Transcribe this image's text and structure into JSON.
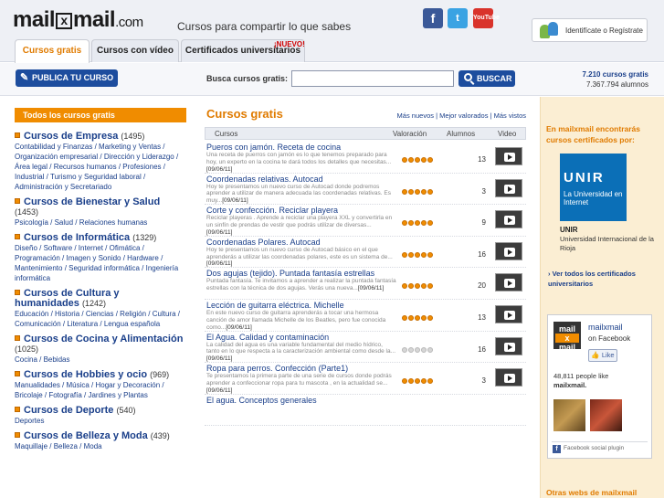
{
  "header": {
    "logo_pre": "mail",
    "logo_x": "x",
    "logo_post": "mail",
    "logo_com": ".com",
    "tagline": "Cursos para compartir lo que sabes",
    "login_label": "Identifícate o Regístrate",
    "facebook_glyph": "f",
    "twitter_glyph": "t",
    "youtube_glyph": "YouTube"
  },
  "tabs": [
    {
      "label": "Cursos gratis",
      "active": true
    },
    {
      "label": "Cursos con vídeo"
    },
    {
      "label": "Certificados universitarios",
      "badge": "¡NUEVO!"
    }
  ],
  "search": {
    "publica_label": "PUBLICA TU CURSO",
    "label": "Busca cursos gratis:",
    "placeholder": "",
    "button_label": "BUSCAR"
  },
  "stats": {
    "courses_count": "7.210",
    "courses_label": "cursos gratis",
    "students": "7.367.794 alumnos"
  },
  "left": {
    "header": "Todos los cursos gratis",
    "categories": [
      {
        "title": "Cursos de Empresa",
        "count": "(1495)",
        "subs": "Contabilidad y Finanzas / Marketing y Ventas / Organización empresarial / Dirección y Liderazgo / Área legal / Recursos humanos / Profesiones / Industrial / Turismo y Seguridad laboral / Administración y Secretariado"
      },
      {
        "title": "Cursos de Bienestar y Salud",
        "count": "(1453)",
        "subs": "Psicología / Salud / Relaciones humanas"
      },
      {
        "title": "Cursos de Informática",
        "count": "(1329)",
        "subs": "Diseño / Software / Internet / Ofimática / Programación / Imagen y Sonido / Hardware / Mantenimiento / Seguridad informática / Ingeniería informática"
      },
      {
        "title": "Cursos de Cultura y humanidades",
        "count": "(1242)",
        "subs": "Educación / Historia / Ciencias / Religión / Cultura / Comunicación / Literatura / Lengua española"
      },
      {
        "title": "Cursos de Cocina y Alimentación",
        "count": "(1025)",
        "subs": "Cocina / Bebidas"
      },
      {
        "title": "Cursos de Hobbies y ocio",
        "count": "(969)",
        "subs": "Manualidades / Música / Hogar y Decoración / Bricolaje / Fotografía / Jardines y Plantas"
      },
      {
        "title": "Cursos de Deporte",
        "count": "(540)",
        "subs": "Deportes"
      },
      {
        "title": "Cursos de Belleza y Moda",
        "count": "(439)",
        "subs": "Maquillaje / Belleza / Moda"
      }
    ]
  },
  "center": {
    "title": "Cursos gratis",
    "sort_links": "Más nuevos | Mejor valorados | Más vistos",
    "columns": {
      "cursos": "Cursos",
      "valoracion": "Valoración",
      "alumnos": "Alumnos",
      "video": "Video"
    },
    "courses": [
      {
        "title": "Pueros con jamón. Receta de cocina",
        "desc": "Una receta de puerros con jamón es lo que tenemos preparado para hoy, un experto en la cocina te dará todos los detalles que necesitas...",
        "date": "[09/06/11]",
        "rating": 5,
        "students": "13"
      },
      {
        "title": "Coordenadas relativas. Autocad",
        "desc": "Hoy te presentamos un nuevo curso de Autocad donde podremos aprender a utilizar de manera adecuada las coordenadas relativas. Es muy...",
        "date": "[09/06/11]",
        "rating": 5,
        "students": "3"
      },
      {
        "title": "Corte y confección. Reciclar playera",
        "desc": "Reciclar playeras . Aprende a reciclar una playera XXL y convertirla en un sinfín de prendas de vestir que podrás utilizar de diversas...",
        "date": "[09/06/11]",
        "rating": 5,
        "students": "9"
      },
      {
        "title": "Coordenadas Polares. Autocad",
        "desc": "Hoy te presentamos un nuevo curso de Autocad básico en el que aprenderás a utilizar las coordenadas polares, este es un sistema de...",
        "date": "[09/06/11]",
        "rating": 5,
        "students": "16"
      },
      {
        "title": "Dos agujas (tejido). Puntada fantasía estrellas",
        "desc": "Puntada fantasía. Te invitamos a aprender a realizar la puntada fantasía estrellas con la técnica de dos agujas. Verás una nueva...",
        "date": "[09/06/11]",
        "rating": 5,
        "students": "20"
      },
      {
        "title": "Lección de guitarra eléctrica. Michelle",
        "desc": "En este nuevo curso de guitarra aprenderás a tocar una hermosa canción de amor llamada Michelle de los Beatles, pero fue conocida como...",
        "date": "[09/06/11]",
        "rating": 5,
        "students": "13"
      },
      {
        "title": "El Agua. Calidad y contaminación",
        "desc": "La calidad del agua es una variable fundamental del medio hídrico, tanto en lo que respecta a la caracterización ambiental como desde la...",
        "date": "[09/06/11]",
        "rating": 0,
        "students": "16"
      },
      {
        "title": "Ropa para perros. Confección (Parte1)",
        "desc": "Te presentamos la primera parte de una serie de cursos donde podrás aprender a confeccionar ropa para tu mascota , en la actualidad se...",
        "date": "[09/06/11]",
        "rating": 5,
        "students": "3"
      },
      {
        "title": "El agua. Conceptos generales",
        "desc": "",
        "date": "",
        "rating": 0,
        "students": ""
      }
    ]
  },
  "right": {
    "heading": "En mailxmail encontrarás cursos certificados por:",
    "unir_big": "UNIR",
    "unir_small": "La Universidad en Internet",
    "unir_name": "UNIR",
    "unir_desc": "Universidad Internacional de la Rioja",
    "ver_todos": "› Ver todos los certificados universitarios",
    "fb": {
      "logo_top": "mail",
      "logo_x": "x",
      "logo_bottom": "mail",
      "name": "mailxmail",
      "on": "on Facebook",
      "like": "Like",
      "people_pre": "48,811 people like",
      "people_name": "mailxmail.",
      "plugin": "Facebook social plugin"
    },
    "otras_webs": "Otras webs de mailxmail"
  },
  "colors": {
    "accent_orange": "#f08c00",
    "brand_blue": "#1d4d9e",
    "link_blue": "#1a3f8a"
  }
}
